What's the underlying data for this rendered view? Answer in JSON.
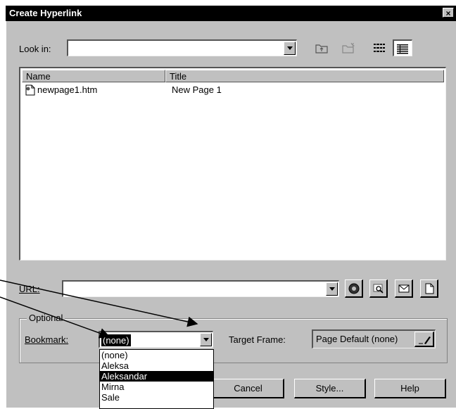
{
  "dialog": {
    "title": "Create Hyperlink",
    "close_glyph": "×"
  },
  "look_in": {
    "label": "Look in:",
    "value": ""
  },
  "toolbar": {
    "up_icon": "up-folder-icon",
    "new_folder_icon": "new-folder-icon",
    "list_icon": "list-view-icon",
    "details_icon": "details-view-icon"
  },
  "file_list": {
    "columns": [
      "Name",
      "Title"
    ],
    "rows": [
      {
        "name": "newpage1.htm",
        "title": "New Page 1"
      }
    ]
  },
  "url": {
    "label": "URL:",
    "value": ""
  },
  "optional": {
    "group_label": "Optional",
    "bookmark_label": "Bookmark:",
    "bookmark_value": "(none)",
    "bookmark_options": [
      "(none)",
      "Aleksa",
      "Aleksandar",
      "Mirna",
      "Sale"
    ],
    "bookmark_selected_index": 2,
    "target_frame_label": "Target Frame:",
    "target_frame_value": "Page Default (none)"
  },
  "buttons": {
    "cancel": "Cancel",
    "style": "Style...",
    "help": "Help"
  }
}
